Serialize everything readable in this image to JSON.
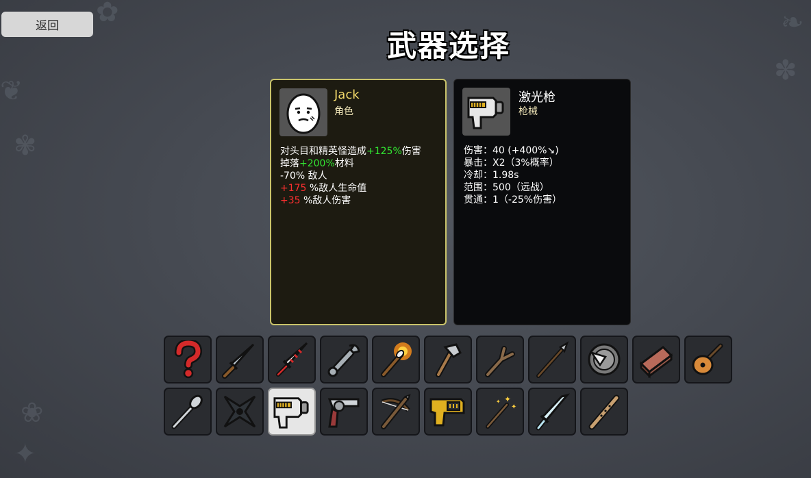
{
  "back_label": "返回",
  "title": "武器选择",
  "character": {
    "name": "Jack",
    "type": "角色",
    "stats": [
      {
        "parts": [
          {
            "t": "对头目和精英怪造成",
            "c": ""
          },
          {
            "t": "+125%",
            "c": "g"
          },
          {
            "t": "伤害",
            "c": ""
          }
        ]
      },
      {
        "parts": [
          {
            "t": "掉落",
            "c": ""
          },
          {
            "t": "+200%",
            "c": "g"
          },
          {
            "t": "材料",
            "c": ""
          }
        ]
      },
      {
        "parts": [
          {
            "t": "-70% 敌人",
            "c": ""
          }
        ]
      },
      {
        "parts": [
          {
            "t": "+175",
            "c": "r"
          },
          {
            "t": " %敌人生命值",
            "c": ""
          }
        ]
      },
      {
        "parts": [
          {
            "t": "+35",
            "c": "r"
          },
          {
            "t": " %敌人伤害",
            "c": ""
          }
        ]
      }
    ]
  },
  "weapon": {
    "name": "激光枪",
    "type": "枪械",
    "stats": [
      "伤害：40 (+400%↘)",
      "暴击：X2（3%概率）",
      "冷却：1.98s",
      "范围：500（远战）",
      "贯通：1（-25%伤害）"
    ]
  },
  "weapons_row1": [
    "random-question-icon",
    "knife-icon",
    "drill-spike-icon",
    "wrench-icon",
    "torch-icon",
    "axe-icon",
    "stick-icon",
    "spear-icon",
    "shield-spike-icon",
    "brick-icon",
    "lute-icon"
  ],
  "weapons_row2": [
    "spoon-icon",
    "shuriken-icon",
    "laser-gun-icon",
    "revolver-icon",
    "crossbow-icon",
    "taser-icon",
    "magic-wand-icon",
    "ice-sword-icon",
    "flute-icon"
  ],
  "selected_weapon": "laser-gun-icon",
  "colors": {
    "accent_border": "#c9c36a",
    "positive": "#32e632",
    "negative": "#ff3030"
  }
}
